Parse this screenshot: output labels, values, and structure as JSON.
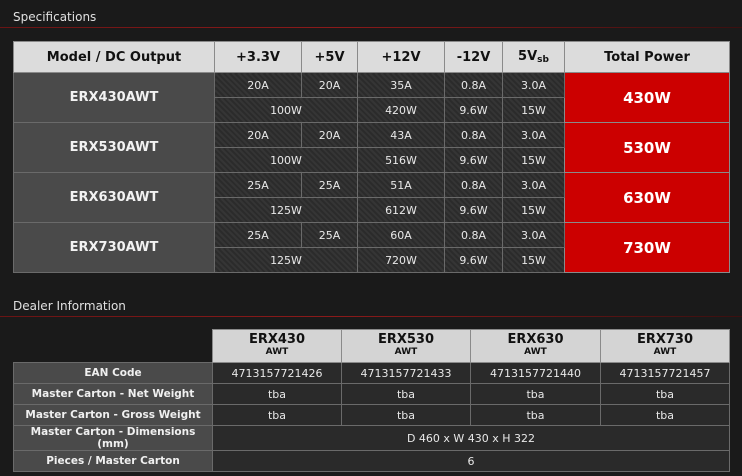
{
  "specifications": {
    "title": "Specifications",
    "headers": {
      "model": "Model / DC Output",
      "v33": "+3.3V",
      "v5": "+5V",
      "v12": "+12V",
      "vneg12": "-12V",
      "v5sb_main": "5V",
      "v5sb_sub": "sb",
      "total": "Total Power"
    },
    "rows": [
      {
        "model": "ERX430AWT",
        "a33": "20A",
        "a5": "20A",
        "a12": "35A",
        "aneg12": "0.8A",
        "a5sb": "3.0A",
        "w335": "100W",
        "w12": "420W",
        "wneg12": "9.6W",
        "w5sb": "15W",
        "total": "430W"
      },
      {
        "model": "ERX530AWT",
        "a33": "20A",
        "a5": "20A",
        "a12": "43A",
        "aneg12": "0.8A",
        "a5sb": "3.0A",
        "w335": "100W",
        "w12": "516W",
        "wneg12": "9.6W",
        "w5sb": "15W",
        "total": "530W"
      },
      {
        "model": "ERX630AWT",
        "a33": "25A",
        "a5": "25A",
        "a12": "51A",
        "aneg12": "0.8A",
        "a5sb": "3.0A",
        "w335": "125W",
        "w12": "612W",
        "wneg12": "9.6W",
        "w5sb": "15W",
        "total": "630W"
      },
      {
        "model": "ERX730AWT",
        "a33": "25A",
        "a5": "25A",
        "a12": "60A",
        "aneg12": "0.8A",
        "a5sb": "3.0A",
        "w335": "125W",
        "w12": "720W",
        "wneg12": "9.6W",
        "w5sb": "15W",
        "total": "730W"
      }
    ]
  },
  "dealer": {
    "title": "Dealer Information",
    "models": [
      {
        "line1": "ERX430",
        "line2": "AWT"
      },
      {
        "line1": "ERX530",
        "line2": "AWT"
      },
      {
        "line1": "ERX630",
        "line2": "AWT"
      },
      {
        "line1": "ERX730",
        "line2": "AWT"
      }
    ],
    "ean": {
      "label": "EAN Code",
      "values": [
        "4713157721426",
        "4713157721433",
        "4713157721440",
        "4713157721457"
      ]
    },
    "net_weight": {
      "label": "Master Carton - Net Weight",
      "values": [
        "tba",
        "tba",
        "tba",
        "tba"
      ]
    },
    "gross_weight": {
      "label": "Master Carton - Gross Weight",
      "values": [
        "tba",
        "tba",
        "tba",
        "tba"
      ]
    },
    "dimensions": {
      "label": "Master Carton - Dimensions (mm)",
      "value": "D 460 x W 430 x H 322"
    },
    "pieces": {
      "label": "Pieces / Master Carton",
      "value": "6"
    }
  }
}
